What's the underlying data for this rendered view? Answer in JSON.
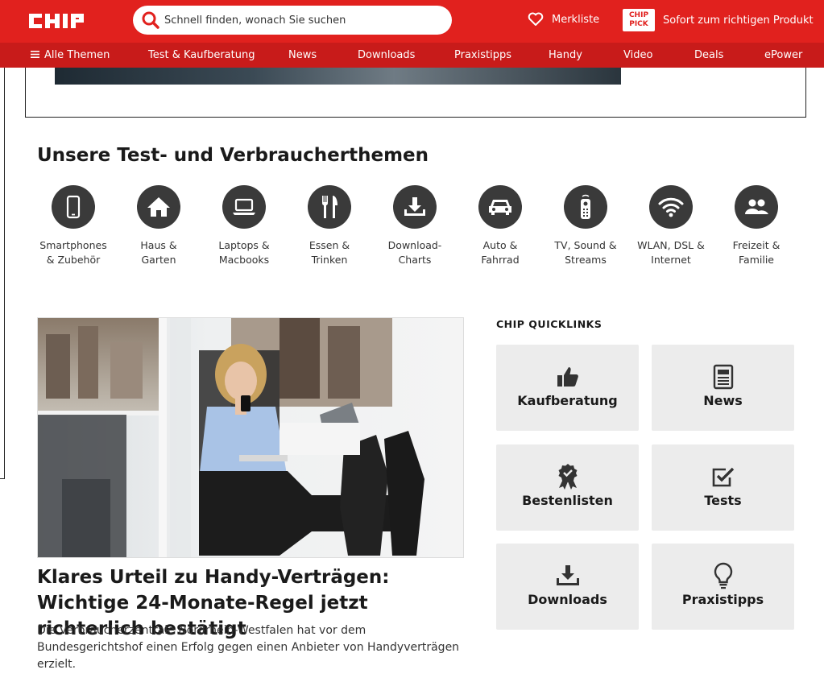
{
  "header": {
    "logo_text": "CHIP",
    "search_placeholder": "Schnell finden, wonach Sie suchen",
    "merkliste_label": "Merkliste",
    "pick_badge_line1": "CHIP",
    "pick_badge_line2": "PICK",
    "pick_label": "Sofort zum richtigen Produkt"
  },
  "nav": {
    "items": [
      {
        "label": "Alle Themen"
      },
      {
        "label": "Test & Kaufberatung"
      },
      {
        "label": "News"
      },
      {
        "label": "Downloads"
      },
      {
        "label": "Praxistipps"
      },
      {
        "label": "Handy"
      },
      {
        "label": "Video"
      },
      {
        "label": "Deals"
      },
      {
        "label": "ePower"
      }
    ]
  },
  "themes": {
    "title": "Unsere Test- und Verbraucherthemen",
    "items": [
      {
        "line1": "Smartphones",
        "line2": "& Zubehör",
        "icon": "smartphone-icon"
      },
      {
        "line1": "Haus &",
        "line2": "Garten",
        "icon": "house-icon"
      },
      {
        "line1": "Laptops &",
        "line2": "Macbooks",
        "icon": "laptop-icon"
      },
      {
        "line1": "Essen &",
        "line2": "Trinken",
        "icon": "cutlery-icon"
      },
      {
        "line1": "Download-",
        "line2": "Charts",
        "icon": "download-icon"
      },
      {
        "line1": "Auto &",
        "line2": "Fahrrad",
        "icon": "car-icon"
      },
      {
        "line1": "TV, Sound &",
        "line2": "Streams",
        "icon": "remote-icon"
      },
      {
        "line1": "WLAN, DSL &",
        "line2": "Internet",
        "icon": "wifi-icon"
      },
      {
        "line1": "Freizeit &",
        "line2": "Familie",
        "icon": "people-icon"
      }
    ]
  },
  "article": {
    "headline": "Klares Urteil zu Handy-Verträgen: Wichtige 24-Monate-Regel jetzt richterlich bestätigt",
    "teaser": "Die Verbraucherzentrale Nordrhein-Westfalen hat vor dem Bundesgerichtshof einen Erfolg gegen einen Anbieter von Handyverträgen erzielt."
  },
  "quicklinks": {
    "title": "CHIP QUICKLINKS",
    "items": [
      {
        "label": "Kaufberatung",
        "icon": "thumbs-up-icon"
      },
      {
        "label": "News",
        "icon": "newspaper-icon"
      },
      {
        "label": "Bestenlisten",
        "icon": "award-icon"
      },
      {
        "label": "Tests",
        "icon": "checkbox-icon"
      },
      {
        "label": "Downloads",
        "icon": "download-tray-icon"
      },
      {
        "label": "Praxistipps",
        "icon": "lightbulb-icon"
      }
    ]
  },
  "colors": {
    "brand_red": "#e1211e",
    "nav_red": "#c81b1a",
    "icon_dark": "#3a3a3a",
    "tile_grey": "#ececec"
  }
}
